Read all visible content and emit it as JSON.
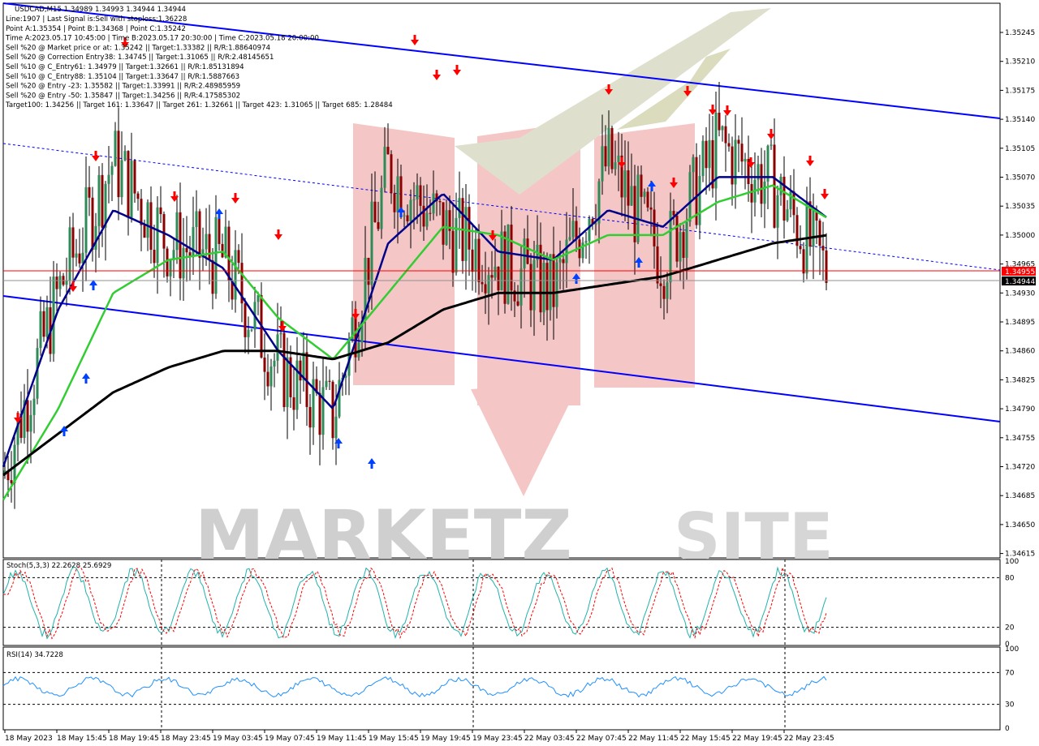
{
  "header": {
    "symbol_line": "USDCAD,M15  1.34989 1.34993 1.34944 1.34944",
    "info_lines": [
      "Line:1907 | Last Signal is:Sell with stoploss:1.36228",
      "Point A:1.35354 | Point B:1.34368 | Point C:1.35242",
      "Time A:2023.05.17 10:45:00 | Time B:2023.05.17 20:30:00 | Time C:2023.05.18 20:00:00",
      "Sell %20 @ Market price or at: 1.35242 || Target:1.33382 || R/R:1.88640974",
      "Sell %20 @ Correction Entry38: 1.34745 || Target:1.31065 || R/R:2.48145651",
      "Sell %10 @ C_Entry61: 1.34979 || Target:1.32661 || R/R:1.85131894",
      "Sell %10 @ C_Entry88: 1.35104 || Target:1.33647 || R/R:1.5887663",
      "Sell %20 @ Entry -23: 1.35582 || Target:1.33991 || R/R:2.48985959",
      "Sell %20 @ Entry -50: 1.35847 || Target:1.34256 || R/R:4.17585302",
      "Target100: 1.34256 || Target 161: 1.33647 || Target 261: 1.32661 || Target 423: 1.31065 || Target 685: 1.28484"
    ]
  },
  "watermark": {
    "text": "MARKETZ",
    "text2": "SITE"
  },
  "price_axis": {
    "ticks": [
      "1.35245",
      "1.35210",
      "1.35175",
      "1.35140",
      "1.35105",
      "1.35070",
      "1.35035",
      "1.35000",
      "1.34965",
      "1.34930",
      "1.34895",
      "1.34860",
      "1.34825",
      "1.34790",
      "1.34755",
      "1.34720",
      "1.34685",
      "1.34650",
      "1.34615"
    ],
    "current_price_label": "1.34955",
    "bid_label": "1.34944",
    "current_price_color": "#ff0000",
    "bid_color": "#000000"
  },
  "time_axis": {
    "labels": [
      "18 May 2023",
      "18 May 15:45",
      "18 May 19:45",
      "18 May 23:45",
      "19 May 03:45",
      "19 May 07:45",
      "19 May 11:45",
      "19 May 15:45",
      "19 May 19:45",
      "19 May 23:45",
      "22 May 03:45",
      "22 May 07:45",
      "22 May 11:45",
      "22 May 15:45",
      "22 May 19:45",
      "22 May 23:45"
    ]
  },
  "stoch_panel": {
    "title": "Stoch(5,3,3) 22.2628 25.6929",
    "scale": [
      "100",
      "80",
      "20",
      "0"
    ],
    "main_color": "#20b2aa",
    "signal_color": "#ff0000"
  },
  "rsi_panel": {
    "title": "RSI(14) 34.7228",
    "scale": [
      "100",
      "70",
      "30",
      "0"
    ],
    "line_color": "#1e90ff"
  },
  "chart_data": {
    "type": "candlestick",
    "symbol": "USDCAD",
    "timeframe": "M15",
    "ylim": [
      1.346,
      1.3527
    ],
    "x": [
      "18 May 2023",
      "18 May 15:45",
      "18 May 19:45",
      "18 May 23:45",
      "19 May 03:45",
      "19 May 07:45",
      "19 May 11:45",
      "19 May 15:45",
      "19 May 19:45",
      "19 May 23:45",
      "22 May 03:45",
      "22 May 07:45",
      "22 May 11:45",
      "22 May 15:45",
      "22 May 19:45",
      "22 May 23:45"
    ],
    "close_approx": [
      1.347,
      1.3492,
      1.3508,
      1.3498,
      1.3496,
      1.3483,
      1.3477,
      1.3507,
      1.35,
      1.3496,
      1.3492,
      1.3508,
      1.3496,
      1.351,
      1.3505,
      1.34944
    ],
    "series": [
      {
        "name": "Moving average fast",
        "color": "#00008b",
        "values": [
          1.3471,
          1.349,
          1.3502,
          1.3499,
          1.3495,
          1.3485,
          1.3478,
          1.3498,
          1.3504,
          1.3497,
          1.3496,
          1.3502,
          1.35,
          1.3506,
          1.3506,
          1.3501
        ]
      },
      {
        "name": "Moving average medium",
        "color": "#32cd32",
        "values": [
          1.3467,
          1.3478,
          1.3492,
          1.3496,
          1.3497,
          1.3489,
          1.3484,
          1.3492,
          1.35,
          1.3499,
          1.3496,
          1.3499,
          1.3499,
          1.3503,
          1.3505,
          1.3501
        ]
      },
      {
        "name": "Moving average slow",
        "color": "#000000",
        "values": [
          1.347,
          1.3475,
          1.348,
          1.3483,
          1.3485,
          1.3485,
          1.3484,
          1.3486,
          1.349,
          1.3492,
          1.3492,
          1.3493,
          1.3494,
          1.3496,
          1.3498,
          1.3499
        ]
      }
    ],
    "channel": {
      "upper_line_color": "#0000ff",
      "lower_line_color": "#0000ff",
      "mid_line_color": "#0000ff"
    },
    "price_lines": {
      "current_price": 1.34955,
      "bid": 1.34944
    },
    "stochastic": {
      "main": 22.2628,
      "signal": 25.6929,
      "levels": [
        80,
        20
      ]
    },
    "rsi": {
      "value": 34.7228,
      "levels": [
        70,
        30
      ]
    }
  }
}
